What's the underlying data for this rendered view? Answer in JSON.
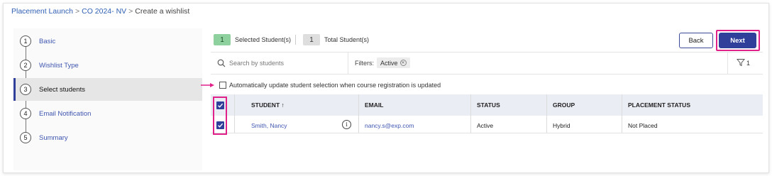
{
  "breadcrumb": {
    "items": [
      "Placement Launch",
      "CO 2024- NV"
    ],
    "current": "Create a wishlist",
    "separator": ">"
  },
  "stepper": {
    "steps": [
      {
        "num": "1",
        "label": "Basic"
      },
      {
        "num": "2",
        "label": "Wishlist Type"
      },
      {
        "num": "3",
        "label": "Select students"
      },
      {
        "num": "4",
        "label": "Email Notification"
      },
      {
        "num": "5",
        "label": "Summary"
      }
    ],
    "active_index": 2
  },
  "counts": {
    "selected_value": "1",
    "selected_label": "Selected Student(s)",
    "total_value": "1",
    "total_label": "Total Student(s)"
  },
  "actions": {
    "back_label": "Back",
    "next_label": "Next"
  },
  "search": {
    "placeholder": "Search by students",
    "icon": "search-icon"
  },
  "filters": {
    "label": "Filters:",
    "chips": [
      "Active"
    ],
    "count": "1",
    "icon": "filter-icon"
  },
  "auto_update": {
    "label": "Automatically update student selection when course registration is updated",
    "checked": false
  },
  "table": {
    "columns": [
      "STUDENT",
      "EMAIL",
      "STATUS",
      "GROUP",
      "PLACEMENT STATUS"
    ],
    "sort_icon": "arrow-up-icon",
    "rows": [
      {
        "selected": true,
        "student": "Smith, Nancy",
        "email": "nancy.s@exp.com",
        "status": "Active",
        "group": "Hybrid",
        "placement_status": "Not Placed"
      }
    ]
  },
  "colors": {
    "primary": "#2f3f9a",
    "highlight": "#e0218a",
    "link": "#3f56b0",
    "selected_badge": "#8fd19e"
  }
}
